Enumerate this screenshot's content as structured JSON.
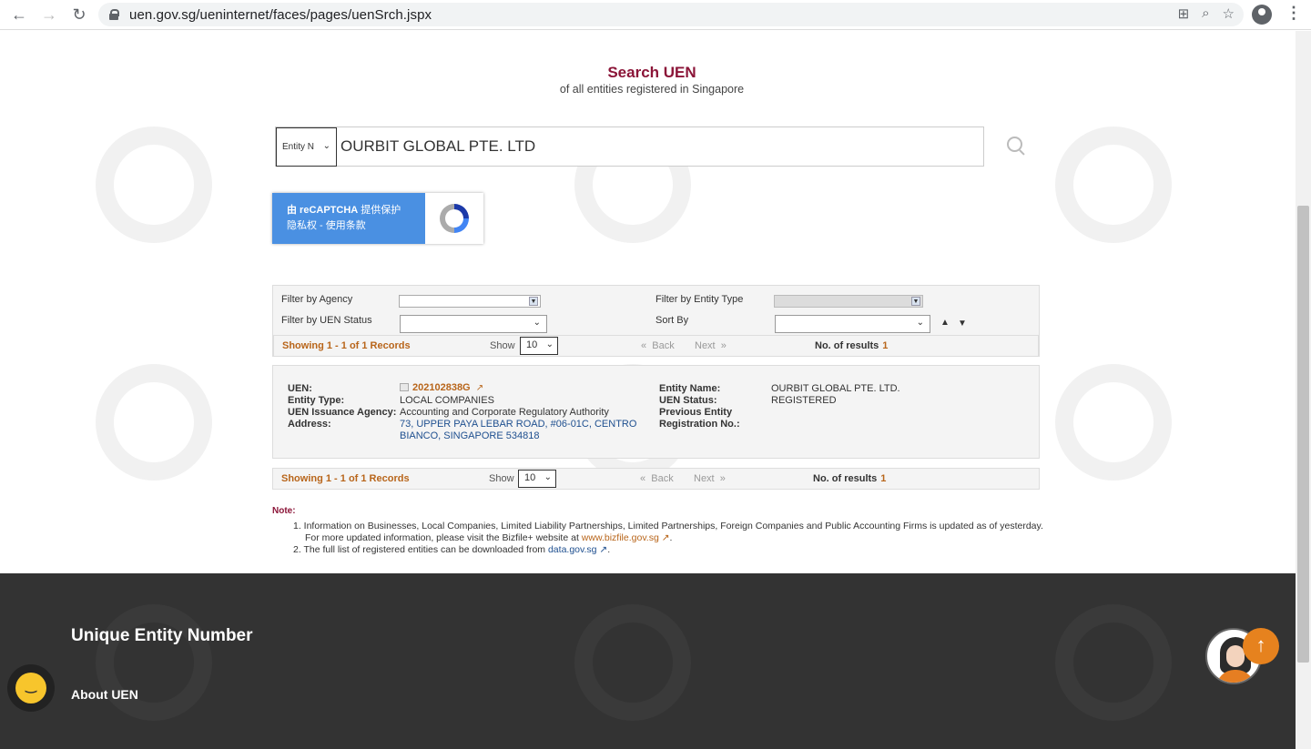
{
  "browser": {
    "url": "uen.gov.sg/ueninternet/faces/pages/uenSrch.jspx"
  },
  "header": {
    "title": "Search UEN",
    "subtitle": "of all entities registered in Singapore"
  },
  "search": {
    "type_option": "Entity N",
    "query": "OURBIT GLOBAL PTE. LTD"
  },
  "captcha": {
    "line1_bold": "由 reCAPTCHA",
    "line1_rest": " 提供保护",
    "line2": "隐私权 - 使用条款"
  },
  "filters": {
    "agency_label": "Filter by Agency",
    "uen_status_label": "Filter by UEN Status",
    "entity_type_label": "Filter by Entity Type",
    "sort_by_label": "Sort By"
  },
  "records": {
    "showing": "Showing 1 - 1 of 1 Records",
    "show_label": "Show",
    "show_value": "10",
    "back": "Back",
    "next": "Next",
    "results_label": "No. of results",
    "results_count": "1"
  },
  "result": {
    "uen_label": "UEN:",
    "uen_value": "202102838G",
    "entity_type_label": "Entity Type:",
    "entity_type_value": "LOCAL COMPANIES",
    "agency_label": "UEN Issuance Agency:",
    "agency_value": "Accounting and Corporate Regulatory Authority",
    "address_label": "Address:",
    "address_line1": "73, UPPER PAYA LEBAR ROAD, #06-01C, CENTRO",
    "address_line2": "BIANCO, SINGAPORE 534818",
    "entity_name_label": "Entity Name:",
    "entity_name_value": "OURBIT GLOBAL PTE. LTD.",
    "uen_status_label": "UEN Status:",
    "uen_status_value": "REGISTERED",
    "prev_reg_label_1": "Previous Entity",
    "prev_reg_label_2": "Registration No.:"
  },
  "note": {
    "title": "Note:",
    "item1_line1": "1. Information on Businesses, Local Companies, Limited Liability Partnerships, Limited Partnerships, Foreign Companies and Public Accounting Firms is updated as of yesterday.",
    "item1_line2_prefix": "For more updated information, please visit the Bizfile+ website at",
    "item1_link": "www.bizfile.gov.sg",
    "item2_prefix": "2. The full list of registered entities can be downloaded from",
    "item2_link": "data.gov.sg"
  },
  "footer": {
    "title": "Unique Entity Number",
    "link": "About UEN"
  },
  "colors": {
    "accent": "#8b1538",
    "orange": "#b8651a",
    "footer_bg": "#333333"
  }
}
